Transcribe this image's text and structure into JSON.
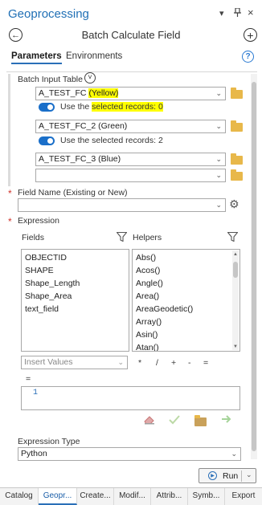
{
  "window": {
    "title": "Geoprocessing",
    "controls": [
      "▾",
      "ᵖ",
      "×"
    ]
  },
  "header": {
    "tool_title": "Batch Calculate Field",
    "back_glyph": "←",
    "add_glyph": "+"
  },
  "tabs": [
    {
      "label": "Parameters",
      "active": true
    },
    {
      "label": "Environments",
      "active": false
    }
  ],
  "help_glyph": "?",
  "batch_input": {
    "label": "Batch Input Table",
    "expand_glyph": "˅",
    "rows": [
      {
        "name_prefix": "A_TEST_FC ",
        "name_highlight": "(Yellow)",
        "toggle_prefix": "Use the ",
        "toggle_highlight": "selected records: 0"
      },
      {
        "name": "A_TEST_FC_2 (Green)",
        "toggle_text": "Use the selected records: 2"
      },
      {
        "name": "A_TEST_FC_3 (Blue)"
      },
      {
        "name": ""
      }
    ]
  },
  "field_name": {
    "label": "Field Name (Existing or New)",
    "required_marker": "*",
    "value": ""
  },
  "expression": {
    "label": "Expression",
    "required_marker": "*",
    "fields_label": "Fields",
    "helpers_label": "Helpers",
    "fields": [
      "OBJECTID",
      "SHAPE",
      "Shape_Length",
      "Shape_Area",
      "text_field"
    ],
    "helpers": [
      "Abs()",
      "Acos()",
      "Angle()",
      "Area()",
      "AreaGeodetic()",
      "Array()",
      "Asin()",
      "Atan()"
    ],
    "insert_values_placeholder": "Insert Values",
    "operators": [
      "*",
      "/",
      "+",
      "-",
      "="
    ],
    "assign": "=",
    "line_number": "1"
  },
  "expression_type": {
    "label": "Expression Type",
    "value": "Python"
  },
  "run_button": {
    "label": "Run"
  },
  "bottom_tabs": [
    {
      "label": "Catalog",
      "active": false
    },
    {
      "label": "Geopr...",
      "active": true
    },
    {
      "label": "Create...",
      "active": false
    },
    {
      "label": "Modif...",
      "active": false
    },
    {
      "label": "Attrib...",
      "active": false
    },
    {
      "label": "Symb...",
      "active": false
    },
    {
      "label": "Export",
      "active": false
    }
  ],
  "colors": {
    "accent": "#1f6fb5",
    "highlight": "#ffff00",
    "required": "#d0342c",
    "toggle_on": "#1a6fc9"
  }
}
